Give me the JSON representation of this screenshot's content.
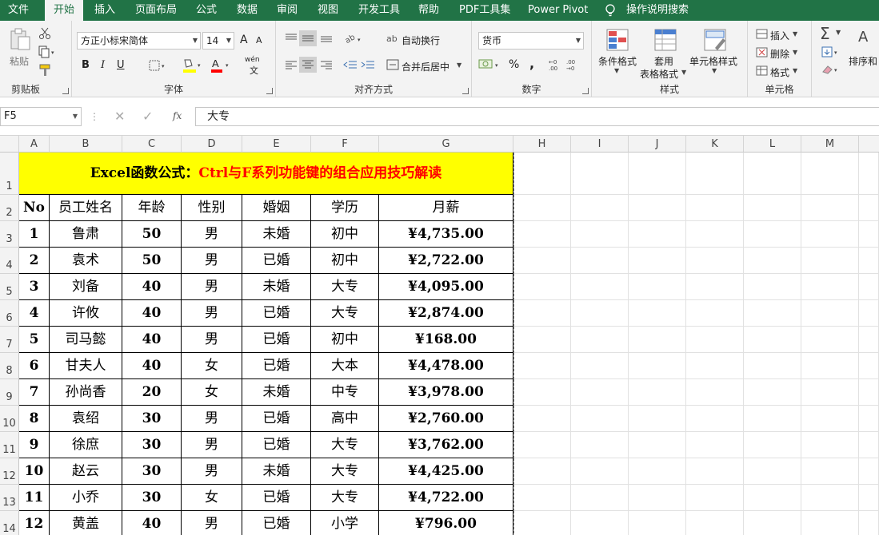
{
  "tabs": [
    "文件",
    "开始",
    "插入",
    "页面布局",
    "公式",
    "数据",
    "审阅",
    "视图",
    "开发工具",
    "帮助",
    "PDF工具集",
    "Power Pivot",
    "操作说明搜索"
  ],
  "ribbon": {
    "clipboard": {
      "label": "剪贴板",
      "paste": "粘贴"
    },
    "font": {
      "label": "字体",
      "name": "方正小标宋简体",
      "size": "14",
      "bold": "B",
      "italic": "I",
      "underline": "U",
      "grow": "A",
      "shrink": "A",
      "phonetic": "wén",
      "phonetic_sub": "文"
    },
    "align": {
      "label": "对齐方式",
      "wrap": "自动换行",
      "merge": "合并后居中"
    },
    "number": {
      "label": "数字",
      "format": "货币",
      "percent": "%",
      "comma": ","
    },
    "styles": {
      "label": "样式",
      "cond": "条件格式",
      "table1": "套用",
      "table2": "表格格式",
      "cellstyle": "单元格样式"
    },
    "cells": {
      "label": "单元格",
      "insert": "插入",
      "delete": "删除",
      "format": "格式"
    },
    "editing": {
      "sort": "排序和"
    }
  },
  "formula_bar": {
    "cell_ref": "F5",
    "fx": "fx",
    "value": "大专"
  },
  "columns": [
    "A",
    "B",
    "C",
    "D",
    "E",
    "F",
    "G",
    "H",
    "I",
    "J",
    "K",
    "L",
    "M"
  ],
  "rows": [
    "1",
    "2",
    "3",
    "4",
    "5",
    "6",
    "7",
    "8",
    "9",
    "10",
    "11",
    "12",
    "13",
    "14"
  ],
  "title": {
    "black": "Excel函数公式：",
    "red": "Ctrl与F系列功能键的组合应用技巧解读"
  },
  "headers": [
    "No",
    "员工姓名",
    "年龄",
    "性别",
    "婚姻",
    "学历",
    "月薪"
  ],
  "table": [
    [
      "1",
      "鲁肃",
      "50",
      "男",
      "未婚",
      "初中",
      "¥4,735.00"
    ],
    [
      "2",
      "袁术",
      "50",
      "男",
      "已婚",
      "初中",
      "¥2,722.00"
    ],
    [
      "3",
      "刘备",
      "40",
      "男",
      "未婚",
      "大专",
      "¥4,095.00"
    ],
    [
      "4",
      "许攸",
      "40",
      "男",
      "已婚",
      "大专",
      "¥2,874.00"
    ],
    [
      "5",
      "司马懿",
      "40",
      "男",
      "已婚",
      "初中",
      "¥168.00"
    ],
    [
      "6",
      "甘夫人",
      "40",
      "女",
      "已婚",
      "大本",
      "¥4,478.00"
    ],
    [
      "7",
      "孙尚香",
      "20",
      "女",
      "未婚",
      "中专",
      "¥3,978.00"
    ],
    [
      "8",
      "袁绍",
      "30",
      "男",
      "已婚",
      "高中",
      "¥2,760.00"
    ],
    [
      "9",
      "徐庶",
      "30",
      "男",
      "已婚",
      "大专",
      "¥3,762.00"
    ],
    [
      "10",
      "赵云",
      "30",
      "男",
      "未婚",
      "大专",
      "¥4,425.00"
    ],
    [
      "11",
      "小乔",
      "30",
      "女",
      "已婚",
      "大专",
      "¥4,722.00"
    ],
    [
      "12",
      "黄盖",
      "40",
      "男",
      "已婚",
      "小学",
      "¥796.00"
    ]
  ],
  "colors": {
    "brand": "#217346",
    "title_bg": "#ffff00",
    "title_red": "#ff0000"
  }
}
